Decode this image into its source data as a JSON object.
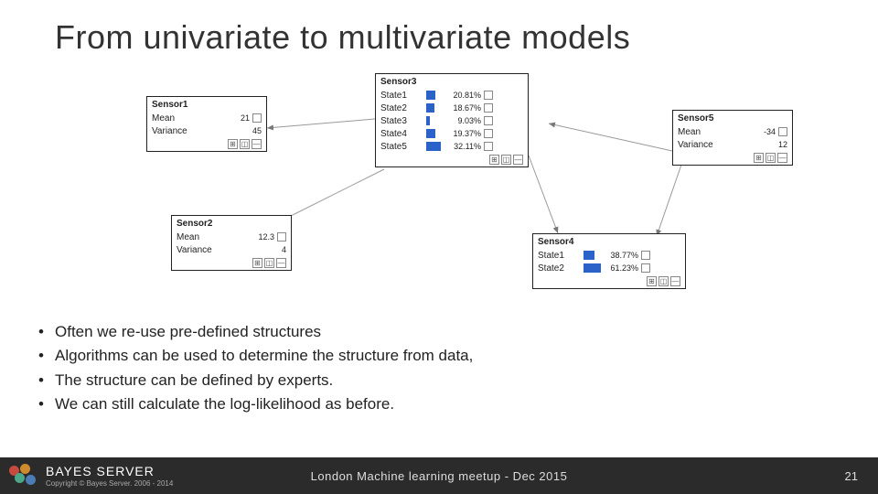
{
  "title": "From univariate to multivariate models",
  "nodes": {
    "sensor1": {
      "title": "Sensor1",
      "rows": [
        {
          "label": "Mean",
          "value": "21"
        },
        {
          "label": "Variance",
          "value": "45"
        }
      ]
    },
    "sensor2": {
      "title": "Sensor2",
      "rows": [
        {
          "label": "Mean",
          "value": "12.3"
        },
        {
          "label": "Variance",
          "value": "4"
        }
      ]
    },
    "sensor3": {
      "title": "Sensor3",
      "rows": [
        {
          "label": "State1",
          "pct": "20.81%",
          "w": 10
        },
        {
          "label": "State2",
          "pct": "18.67%",
          "w": 9
        },
        {
          "label": "State3",
          "pct": "9.03%",
          "w": 4
        },
        {
          "label": "State4",
          "pct": "19.37%",
          "w": 10
        },
        {
          "label": "State5",
          "pct": "32.11%",
          "w": 16
        }
      ]
    },
    "sensor4": {
      "title": "Sensor4",
      "rows": [
        {
          "label": "State1",
          "pct": "38.77%",
          "w": 12
        },
        {
          "label": "State2",
          "pct": "61.23%",
          "w": 19
        }
      ]
    },
    "sensor5": {
      "title": "Sensor5",
      "rows": [
        {
          "label": "Mean",
          "value": "-34"
        },
        {
          "label": "Variance",
          "value": "12"
        }
      ]
    }
  },
  "bullets": [
    "Often we re-use pre-defined structures",
    "Algorithms can be used to determine the structure from data,",
    "The structure can be defined by experts.",
    "We can still calculate the log-likelihood as before."
  ],
  "footer": {
    "brand": "BAYES SERVER",
    "copyright": "Copyright © Bayes Server. 2006 - 2014",
    "center": "London Machine learning meetup - Dec 2015",
    "page": "21"
  },
  "colors": {
    "logo": [
      "#c74a3f",
      "#cf8b2e",
      "#4aa78a",
      "#4a7db5"
    ]
  }
}
